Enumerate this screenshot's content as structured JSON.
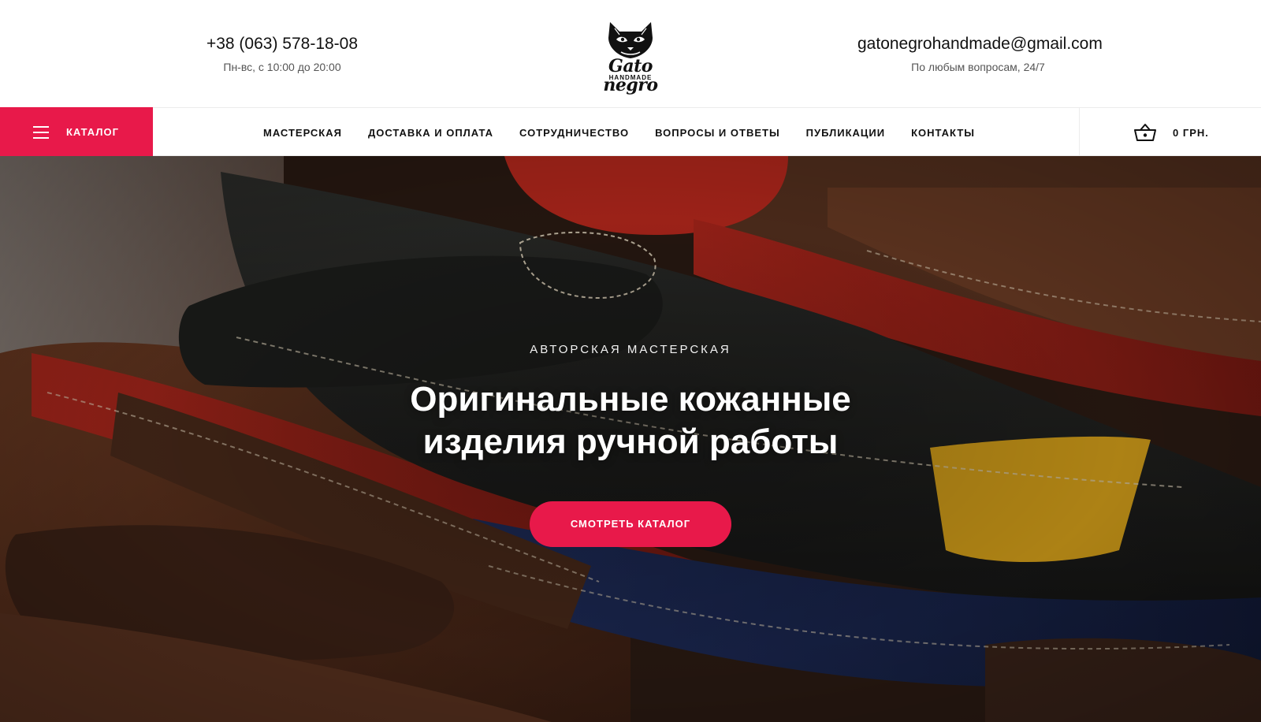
{
  "header": {
    "phone": "+38 (063) 578-18-08",
    "hours": "Пн-вс, с 10:00 до 20:00",
    "email": "gatonegrohandmade@gmail.com",
    "email_note": "По любым вопросам, 24/7",
    "logo": {
      "wordmark": "Gato negro",
      "subword": "HANDMADE",
      "icon": "black-cat-head-icon"
    }
  },
  "nav": {
    "catalog_label": "КАТАЛОГ",
    "menu_icon": "hamburger-menu-icon",
    "items": [
      {
        "label": "МАСТЕРСКАЯ"
      },
      {
        "label": "ДОСТАВКА И ОПЛАТА"
      },
      {
        "label": "СОТРУДНИЧЕСТВО"
      },
      {
        "label": "ВОПРОСЫ И ОТВЕТЫ"
      },
      {
        "label": "ПУБЛИКАЦИИ"
      },
      {
        "label": "КОНТАКТЫ"
      }
    ],
    "cart": {
      "icon": "shopping-basket-icon",
      "total": "0 ГРН."
    }
  },
  "hero": {
    "eyebrow": "АВТОРСКАЯ МАСТЕРСКАЯ",
    "headline_line1": "Оригинальные кожанные",
    "headline_line2": "изделия ручной работы",
    "cta_label": "СМОТРЕТЬ КАТАЛОГ"
  },
  "colors": {
    "accent": "#e8194a",
    "text": "#111111",
    "muted": "#555555",
    "border": "#ececec"
  }
}
